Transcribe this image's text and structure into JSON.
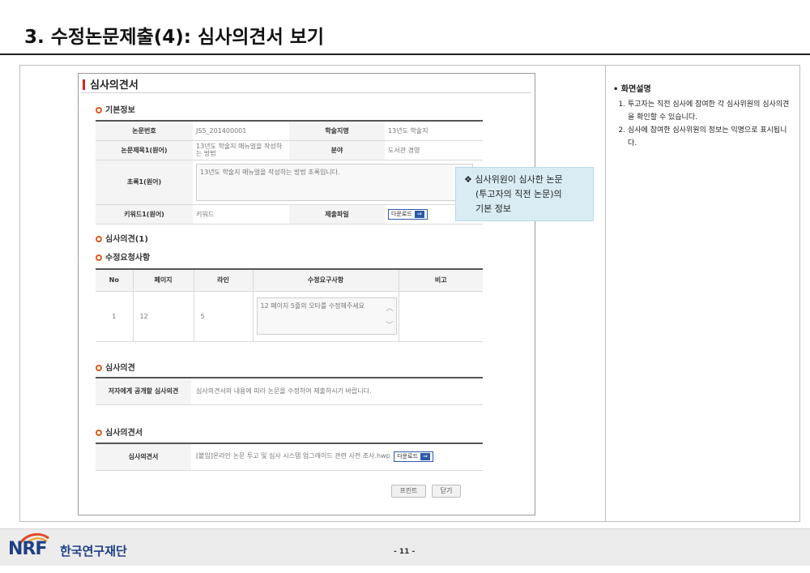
{
  "slide": {
    "title": "3. 수정논문제출(4): 심사의견서 보기",
    "page_number": "- 11 -"
  },
  "window": {
    "title": "심사의견서"
  },
  "basic_info": {
    "section_title": "기본정보",
    "rows": {
      "paper_no_label": "논문번호",
      "paper_no_value": "JS5_201400001",
      "journal_label": "학술지명",
      "journal_value": "13년도 학술지",
      "paper_title_label": "논문제목1(원어)",
      "paper_title_value": "13년도 학술지 매뉴얼을 작성하는 방법",
      "field_label": "분야",
      "field_value": "도서관 경영",
      "abstract_label": "초록1(원어)",
      "abstract_value": "13년도 학술지 매뉴얼을 작성하는 방법 초록입니다.",
      "keyword_label": "키워드1(원어)",
      "keyword_value": "키워드",
      "file_label": "제출파일",
      "download_label": "다운로드"
    }
  },
  "review_count_title": "심사의견(1)",
  "revision_requests": {
    "section_title": "수정요청사항",
    "headers": [
      "No",
      "페이지",
      "라인",
      "수정요구사항",
      "비고"
    ],
    "rows": [
      {
        "no": "1",
        "page": "12",
        "line": "5",
        "request": "12 페이지 5줄의 오타를 수정해주세요",
        "note": ""
      }
    ]
  },
  "review_opinion": {
    "section_title": "심사의견",
    "label": "저자에게 공개할 심사의견",
    "value": "심사의견서의 내용에 따라 논문을 수정하여 제출하시기 바랍니다."
  },
  "review_document": {
    "section_title": "심사의견서",
    "label": "심사의견서",
    "file_name": "[붙임]온라인 논문 투고 및 심사 시스템 업그레이드 관련 사전 조사.hwp",
    "download_label": "다운로드"
  },
  "buttons": {
    "print": "프린트",
    "close": "닫기"
  },
  "callout": {
    "marker": "❖",
    "lines": [
      "심사위원이 심사한 논문",
      "(투고자의 직전 논문)의",
      "기본 정보"
    ]
  },
  "description": {
    "heading": "• 화면설명",
    "items": [
      "투고자는 직전 심사에 참여한 각 심사위원의 심사의견을 확인할 수 있습니다.",
      "심사에 참여한 심사위원의 정보는 익명으로 표시됩니다."
    ]
  },
  "footer": {
    "logo_text": "NRF",
    "org_name": "한국연구재단"
  },
  "colors": {
    "accent_red": "#e02020",
    "section_dot": "#e05a1a",
    "callout_bg": "#d9ecf4",
    "brand_blue": "#1e3f86"
  }
}
